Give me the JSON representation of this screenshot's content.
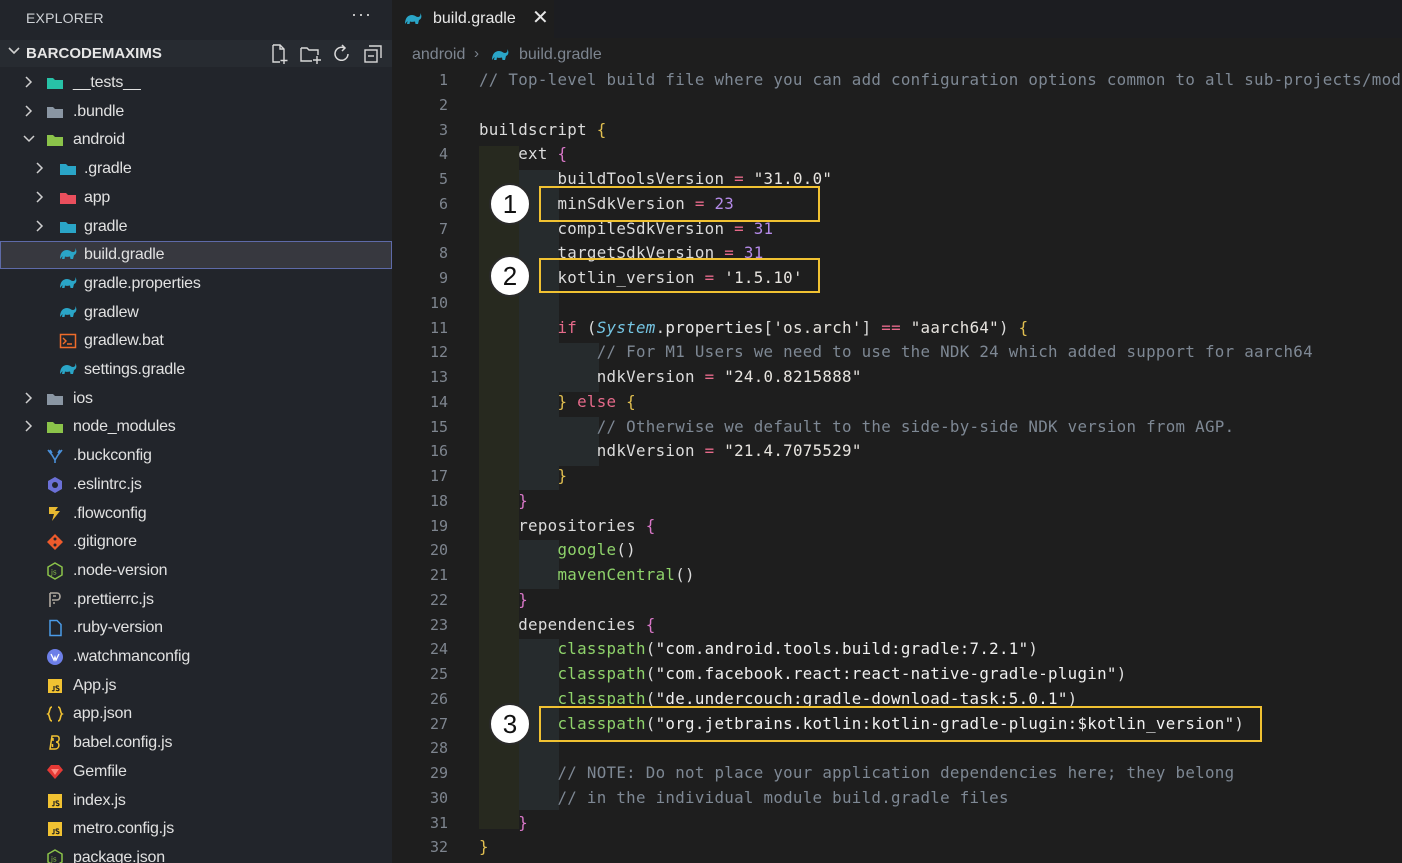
{
  "explorer": {
    "title": "EXPLORER",
    "more": "···"
  },
  "folder": {
    "name": "BARCODEMAXIMS"
  },
  "tree": [
    {
      "label": "__tests__",
      "depth": 0,
      "chevron": "right",
      "icon": "tests-folder-icon",
      "color": "#27c2a7"
    },
    {
      "label": ".bundle",
      "depth": 0,
      "chevron": "right",
      "icon": "folder-icon",
      "color": "#8a96a3"
    },
    {
      "label": "android",
      "depth": 0,
      "chevron": "down",
      "icon": "android-folder-icon",
      "color": "#8bc34a"
    },
    {
      "label": ".gradle",
      "depth": 1,
      "chevron": "right",
      "icon": "gradle-folder-icon",
      "color": "#2aa5c7"
    },
    {
      "label": "app",
      "depth": 1,
      "chevron": "right",
      "icon": "app-folder-icon",
      "color": "#ea4f5d"
    },
    {
      "label": "gradle",
      "depth": 1,
      "chevron": "right",
      "icon": "gradle-folder-icon",
      "color": "#2aa5c7"
    },
    {
      "label": "build.gradle",
      "depth": 1,
      "chevron": "none",
      "icon": "gradle-icon",
      "color": "#2aa5c7",
      "selected": true
    },
    {
      "label": "gradle.properties",
      "depth": 1,
      "chevron": "none",
      "icon": "gradle-icon",
      "color": "#2aa5c7"
    },
    {
      "label": "gradlew",
      "depth": 1,
      "chevron": "none",
      "icon": "gradle-icon",
      "color": "#2aa5c7"
    },
    {
      "label": "gradlew.bat",
      "depth": 1,
      "chevron": "none",
      "icon": "terminal-icon",
      "color": "#ef6c2a"
    },
    {
      "label": "settings.gradle",
      "depth": 1,
      "chevron": "none",
      "icon": "gradle-icon",
      "color": "#2aa5c7"
    },
    {
      "label": "ios",
      "depth": 0,
      "chevron": "right",
      "icon": "ios-folder-icon",
      "color": "#8a96a3"
    },
    {
      "label": "node_modules",
      "depth": 0,
      "chevron": "right",
      "icon": "node-folder-icon",
      "color": "#8bc34a"
    },
    {
      "label": ".buckconfig",
      "depth": 0,
      "chevron": "none",
      "icon": "buck-icon",
      "color": "#4a90d9"
    },
    {
      "label": ".eslintrc.js",
      "depth": 0,
      "chevron": "none",
      "icon": "eslint-icon",
      "color": "#6b70d6"
    },
    {
      "label": ".flowconfig",
      "depth": 0,
      "chevron": "none",
      "icon": "flow-icon",
      "color": "#e8b931"
    },
    {
      "label": ".gitignore",
      "depth": 0,
      "chevron": "none",
      "icon": "git-icon",
      "color": "#ef5b2c"
    },
    {
      "label": ".node-version",
      "depth": 0,
      "chevron": "none",
      "icon": "nodejs-icon",
      "color": "#8bc34a"
    },
    {
      "label": ".prettierrc.js",
      "depth": 0,
      "chevron": "none",
      "icon": "prettier-icon",
      "color": "#b0a9a0"
    },
    {
      "label": ".ruby-version",
      "depth": 0,
      "chevron": "none",
      "icon": "file-icon",
      "color": "#4a9be8"
    },
    {
      "label": ".watchmanconfig",
      "depth": 0,
      "chevron": "none",
      "icon": "watchman-icon",
      "color": "#6d7fe8"
    },
    {
      "label": "App.js",
      "depth": 0,
      "chevron": "none",
      "icon": "js-icon",
      "color": "#f1c232"
    },
    {
      "label": "app.json",
      "depth": 0,
      "chevron": "none",
      "icon": "json-icon",
      "color": "#f1c232"
    },
    {
      "label": "babel.config.js",
      "depth": 0,
      "chevron": "none",
      "icon": "babel-icon",
      "color": "#f1c232"
    },
    {
      "label": "Gemfile",
      "depth": 0,
      "chevron": "none",
      "icon": "ruby-icon",
      "color": "#e53935"
    },
    {
      "label": "index.js",
      "depth": 0,
      "chevron": "none",
      "icon": "js-icon",
      "color": "#f1c232"
    },
    {
      "label": "metro.config.js",
      "depth": 0,
      "chevron": "none",
      "icon": "js-icon",
      "color": "#f1c232"
    },
    {
      "label": "package.json",
      "depth": 0,
      "chevron": "none",
      "icon": "nodejs-icon",
      "color": "#8bc34a"
    }
  ],
  "tab": {
    "label": "build.gradle",
    "close": "✕"
  },
  "breadcrumb": {
    "folder": "android",
    "sep": "›",
    "file": "build.gradle"
  },
  "code": [
    {
      "n": "1",
      "t": [
        [
          "c",
          "// Top-level build file where you can add configuration options common to all sub-projects/modules."
        ]
      ]
    },
    {
      "n": "2",
      "t": []
    },
    {
      "n": "3",
      "t": [
        [
          "k",
          "buildscript "
        ],
        [
          "br2",
          "{"
        ]
      ]
    },
    {
      "n": "4",
      "t": [
        [
          "k",
          "    ext "
        ],
        [
          "br",
          "{"
        ]
      ]
    },
    {
      "n": "5",
      "t": [
        [
          "k",
          "        buildToolsVersion "
        ],
        [
          "o",
          "="
        ],
        [
          "s",
          " \"31.0.0\""
        ]
      ]
    },
    {
      "n": "6",
      "t": [
        [
          "k",
          "        minSdkVersion "
        ],
        [
          "o",
          "="
        ],
        [
          "n",
          " 23"
        ]
      ]
    },
    {
      "n": "7",
      "t": [
        [
          "k",
          "        compileSdkVersion "
        ],
        [
          "o",
          "="
        ],
        [
          "n",
          " 31"
        ]
      ]
    },
    {
      "n": "8",
      "t": [
        [
          "k",
          "        targetSdkVersion "
        ],
        [
          "o",
          "="
        ],
        [
          "n",
          " 31"
        ]
      ]
    },
    {
      "n": "9",
      "t": [
        [
          "k",
          "        kotlin_version "
        ],
        [
          "o",
          "="
        ],
        [
          "s",
          " '1.5.10'"
        ]
      ]
    },
    {
      "n": "10",
      "t": []
    },
    {
      "n": "11",
      "t": [
        [
          "kw",
          "        if "
        ],
        [
          "k",
          "("
        ],
        [
          "cls",
          "System"
        ],
        [
          "k",
          "."
        ],
        [
          "pp",
          "properties"
        ],
        [
          "k",
          "["
        ],
        [
          "s",
          "'os.arch'"
        ],
        [
          "k",
          "] "
        ],
        [
          "o",
          "=="
        ],
        [
          "s",
          " \"aarch64\""
        ],
        [
          "k",
          ") "
        ],
        [
          "br2",
          "{"
        ]
      ]
    },
    {
      "n": "12",
      "t": [
        [
          "c",
          "            // For M1 Users we need to use the NDK 24 which added support for aarch64"
        ]
      ]
    },
    {
      "n": "13",
      "t": [
        [
          "k",
          "            ndkVersion "
        ],
        [
          "o",
          "="
        ],
        [
          "s",
          " \"24.0.8215888\""
        ]
      ]
    },
    {
      "n": "14",
      "t": [
        [
          "br2",
          "        }"
        ],
        [
          "kw",
          " else "
        ],
        [
          "br2",
          "{"
        ]
      ]
    },
    {
      "n": "15",
      "t": [
        [
          "c",
          "            // Otherwise we default to the side-by-side NDK version from AGP."
        ]
      ]
    },
    {
      "n": "16",
      "t": [
        [
          "k",
          "            ndkVersion "
        ],
        [
          "o",
          "="
        ],
        [
          "s",
          " \"21.4.7075529\""
        ]
      ]
    },
    {
      "n": "17",
      "t": [
        [
          "br2",
          "        }"
        ]
      ]
    },
    {
      "n": "18",
      "t": [
        [
          "br",
          "    }"
        ]
      ]
    },
    {
      "n": "19",
      "t": [
        [
          "k",
          "    repositories "
        ],
        [
          "br",
          "{"
        ]
      ]
    },
    {
      "n": "20",
      "t": [
        [
          "f",
          "        google"
        ],
        [
          "k",
          "()"
        ]
      ]
    },
    {
      "n": "21",
      "t": [
        [
          "f",
          "        mavenCentral"
        ],
        [
          "k",
          "()"
        ]
      ]
    },
    {
      "n": "22",
      "t": [
        [
          "br",
          "    }"
        ]
      ]
    },
    {
      "n": "23",
      "t": [
        [
          "k",
          "    dependencies "
        ],
        [
          "br",
          "{"
        ]
      ]
    },
    {
      "n": "24",
      "t": [
        [
          "f",
          "        classpath"
        ],
        [
          "k",
          "("
        ],
        [
          "st",
          "\"com.android.tools.build:gradle:7.2.1\""
        ],
        [
          "k",
          ")"
        ]
      ]
    },
    {
      "n": "25",
      "t": [
        [
          "f",
          "        classpath"
        ],
        [
          "k",
          "("
        ],
        [
          "st",
          "\"com.facebook.react:react-native-gradle-plugin\""
        ],
        [
          "k",
          ")"
        ]
      ]
    },
    {
      "n": "26",
      "t": [
        [
          "f",
          "        classpath"
        ],
        [
          "k",
          "("
        ],
        [
          "st",
          "\"de.undercouch:gradle-download-task:5.0.1\""
        ],
        [
          "k",
          ")"
        ]
      ]
    },
    {
      "n": "27",
      "t": [
        [
          "f",
          "        classpath"
        ],
        [
          "k",
          "("
        ],
        [
          "st",
          "\"org.jetbrains.kotlin:kotlin-gradle-plugin:$kotlin_version\""
        ],
        [
          "k",
          ")"
        ]
      ]
    },
    {
      "n": "28",
      "t": []
    },
    {
      "n": "29",
      "t": [
        [
          "c",
          "        // NOTE: Do not place your application dependencies here; they belong"
        ]
      ]
    },
    {
      "n": "30",
      "t": [
        [
          "c",
          "        // in the individual module build.gradle files"
        ]
      ]
    },
    {
      "n": "31",
      "t": [
        [
          "br",
          "    }"
        ]
      ]
    },
    {
      "n": "32",
      "t": [
        [
          "br2",
          "}"
        ]
      ]
    }
  ],
  "annotations": [
    "1",
    "2",
    "3"
  ],
  "colors": {
    "highlight": "#f1c232",
    "sidebar_bg": "#22252b",
    "editor_bg": "#1e1e1e",
    "selection_border": "#5e6aa8"
  }
}
